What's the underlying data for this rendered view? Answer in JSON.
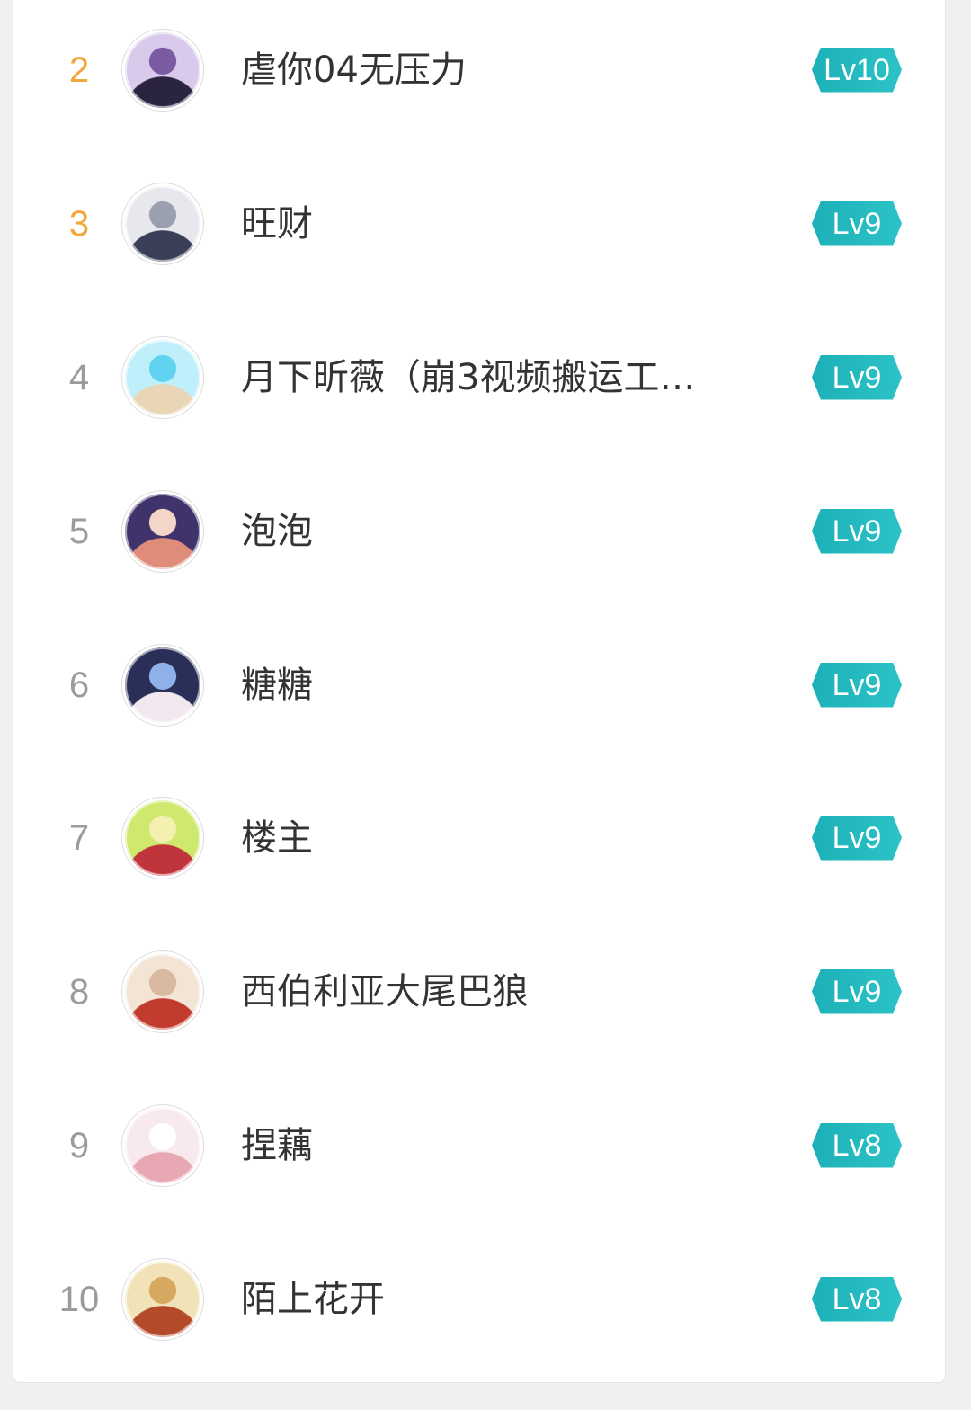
{
  "leaderboard": {
    "rows": [
      {
        "rank": "2",
        "name": "虐你04无压力",
        "level": "Lv10",
        "top": true,
        "avatar_colors": [
          "#d9c9ea",
          "#7a5aa0",
          "#2b2440"
        ]
      },
      {
        "rank": "3",
        "name": "旺财",
        "level": "Lv9",
        "top": true,
        "avatar_colors": [
          "#e6e8ee",
          "#9aa0b0",
          "#3a3f58"
        ]
      },
      {
        "rank": "4",
        "name": "月下昕薇（崩3视频搬运工…",
        "level": "Lv9",
        "top": false,
        "avatar_colors": [
          "#bfeffb",
          "#5fd3f0",
          "#e9d6b5"
        ]
      },
      {
        "rank": "5",
        "name": "泡泡",
        "level": "Lv9",
        "top": false,
        "avatar_colors": [
          "#40336b",
          "#f4d6c8",
          "#e08c7a"
        ]
      },
      {
        "rank": "6",
        "name": "糖糖",
        "level": "Lv9",
        "top": false,
        "avatar_colors": [
          "#2a2f58",
          "#8fb0e8",
          "#f2e9f0"
        ]
      },
      {
        "rank": "7",
        "name": "楼主",
        "level": "Lv9",
        "top": false,
        "avatar_colors": [
          "#cfe86e",
          "#f3f0b0",
          "#c0343c"
        ]
      },
      {
        "rank": "8",
        "name": "西伯利亚大尾巴狼",
        "level": "Lv9",
        "top": false,
        "avatar_colors": [
          "#f3e4d6",
          "#d9b9a0",
          "#c23b2f"
        ]
      },
      {
        "rank": "9",
        "name": "捏藕",
        "level": "Lv8",
        "top": false,
        "avatar_colors": [
          "#f8e9ee",
          "#ffffff",
          "#e7a7b3"
        ]
      },
      {
        "rank": "10",
        "name": "陌上花开",
        "level": "Lv8",
        "top": false,
        "avatar_colors": [
          "#f1e2b8",
          "#d6a860",
          "#b34a2a"
        ]
      }
    ]
  }
}
